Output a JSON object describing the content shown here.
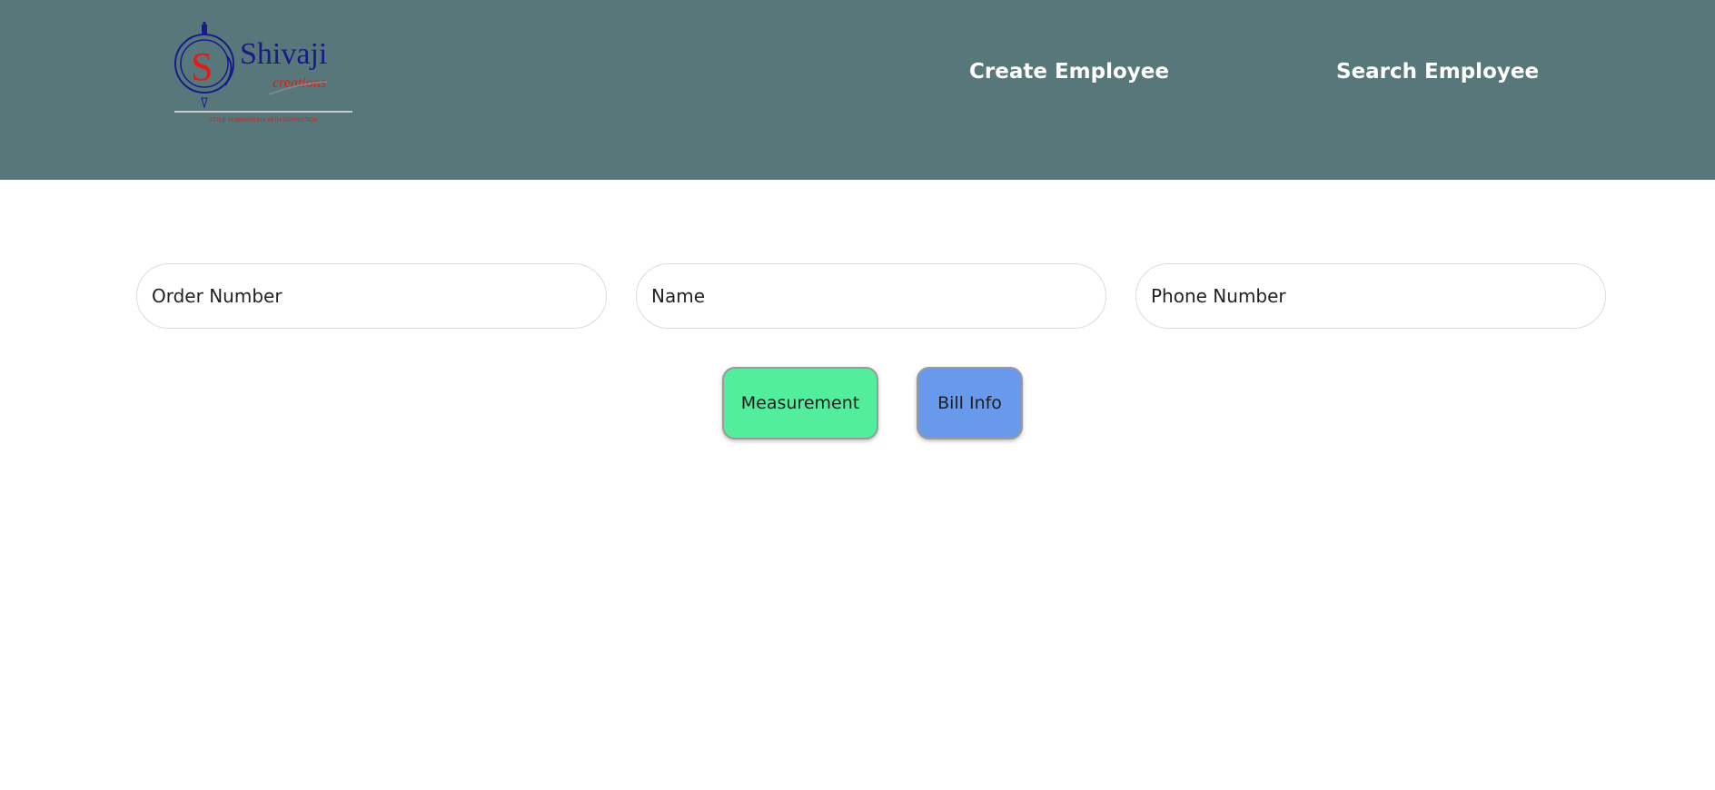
{
  "header": {
    "logo": {
      "brand": "Shivaji",
      "script_word": "creations",
      "initial": "S",
      "tagline": "STYLE SUBMISSIONS WITH PERFECTION"
    },
    "nav": {
      "create_label": "Create Employee",
      "search_label": "Search Employee"
    }
  },
  "form": {
    "order_placeholder": "Order Number",
    "name_placeholder": "Name",
    "phone_placeholder": "Phone Number"
  },
  "actions": {
    "measurement_label": "Measurement",
    "bill_label": "Bill Info"
  },
  "colors": {
    "header_bg": "#58777a",
    "measurement_bg": "#52ee9e",
    "bill_bg": "#6899ea"
  }
}
